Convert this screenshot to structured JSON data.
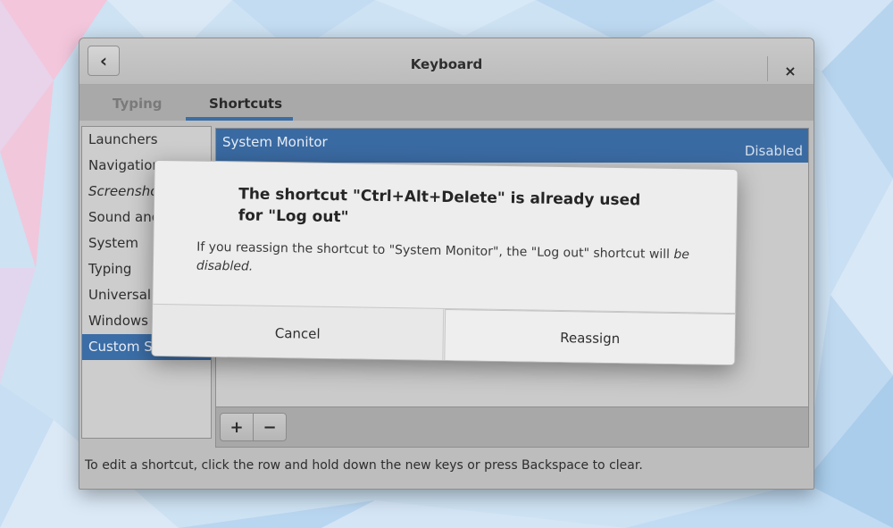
{
  "window": {
    "title": "Keyboard",
    "back_icon": "‹",
    "close_icon": "×"
  },
  "tabs": [
    {
      "label": "Typing",
      "active": false
    },
    {
      "label": "Shortcuts",
      "active": true
    }
  ],
  "sidebar": {
    "items": [
      {
        "label": "Launchers"
      },
      {
        "label": "Navigation"
      },
      {
        "label": "Screensho"
      },
      {
        "label": "Sound and"
      },
      {
        "label": "System"
      },
      {
        "label": "Typing"
      },
      {
        "label": "Universal A"
      },
      {
        "label": "Windows"
      },
      {
        "label": "Custom S"
      }
    ]
  },
  "list": {
    "rows": [
      {
        "name": "System Monitor",
        "status": "Disabled"
      }
    ]
  },
  "toolbar": {
    "add_label": "+",
    "remove_label": "−"
  },
  "hint": "To edit a shortcut, click the row and hold down the new keys or press Backspace to clear.",
  "dialog": {
    "heading": "The shortcut \"Ctrl+Alt+Delete\" is already used for \"Log out\"",
    "body_main": "If you reassign the shortcut to \"System Monitor\", the \"Log out\" shortcut will",
    "body_end": "be disabled.",
    "cancel_label": "Cancel",
    "reassign_label": "Reassign"
  },
  "colors": {
    "accent": "#3a6aa2",
    "window_bg": "#bdbdbd",
    "dialog_bg": "#ededed"
  }
}
